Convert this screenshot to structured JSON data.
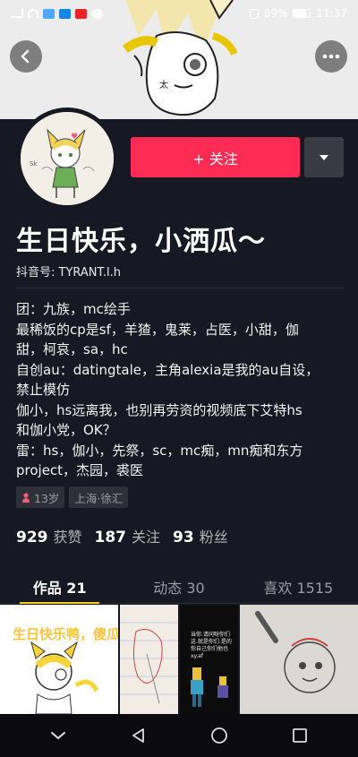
{
  "status_bar": {
    "battery": "89%",
    "time": "11:37"
  },
  "header": {
    "follow_label": "+ 关注"
  },
  "profile": {
    "nickname": "生日快乐，小洒瓜～",
    "douyin_id": "抖音号: TYRANT.l.h",
    "bio_lines": [
      "团：九族，mc绘手",
      "最稀饭的cp是sf，羊猹，鬼莱，占医，小甜，伽",
      "甜，柯哀，sa，hc",
      "自创au：datingtale，主角alexia是我的au自设，",
      "禁止模仿",
      "伽小，hs远离我，也别再劳资的视频底下艾特hs",
      "和伽小党，OK？",
      "雷：hs，伽小，先祭，sc，mc痴，mn痴和东方",
      "project，杰园，裘医"
    ],
    "tags": {
      "age": "13岁",
      "location": "上海·徐汇"
    },
    "stats": [
      {
        "num": "929",
        "label": "获赞"
      },
      {
        "num": "187",
        "label": "关注"
      },
      {
        "num": "93",
        "label": "粉丝"
      }
    ]
  },
  "tabs": [
    {
      "label": "作品 21",
      "active": true
    },
    {
      "label": "动态 30",
      "active": false
    },
    {
      "label": "喜欢 1515",
      "active": false
    }
  ],
  "thumbnails": {
    "first_caption": "生日快乐鸭，傻瓜",
    "third_caption": "当你.请问呀你们这.就是你们.是的你自己你们他也xy.af"
  },
  "colors": {
    "background": "#161823",
    "follow_button": "#fe2c55",
    "tab_indicator": "#face15",
    "caption_yellow": "#ffc23d"
  },
  "icons": {
    "back": "chevron-left-icon",
    "more": "more-dots-icon",
    "dropdown": "triangle-down-icon",
    "gender": "female-icon",
    "nav_back": "triangle-back-icon",
    "nav_home": "circle-home-icon",
    "nav_recent": "square-recent-icon"
  }
}
